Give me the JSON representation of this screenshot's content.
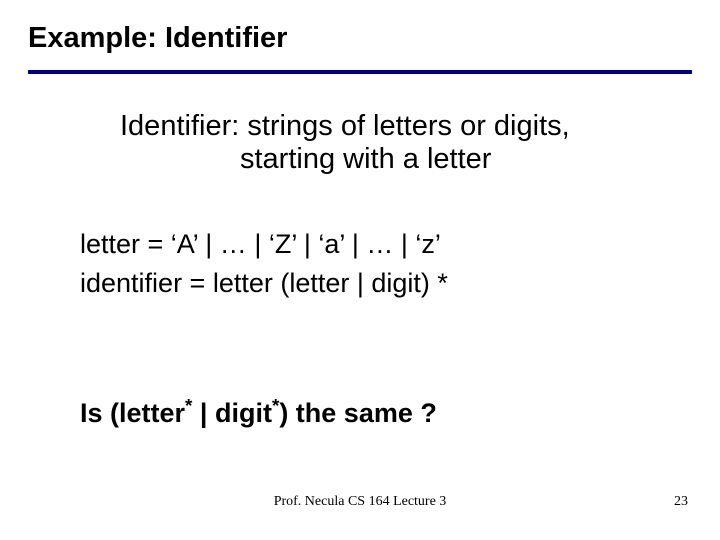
{
  "title": "Example: Identifier",
  "definition": {
    "line1": "Identifier: strings of letters or digits,",
    "line2": "starting with a letter"
  },
  "grammar": {
    "letter_rule": "letter = ‘A’ | … | ‘Z’ | ‘a’ | … | ‘z’",
    "identifier_rule": "identifier = letter (letter | digit) *"
  },
  "question": {
    "prefix": "Is (letter",
    "sup1": "*",
    "mid": " | digit",
    "sup2": "*",
    "suffix": ") the same ?"
  },
  "footer": "Prof. Necula  CS 164  Lecture 3",
  "page_number": "23"
}
